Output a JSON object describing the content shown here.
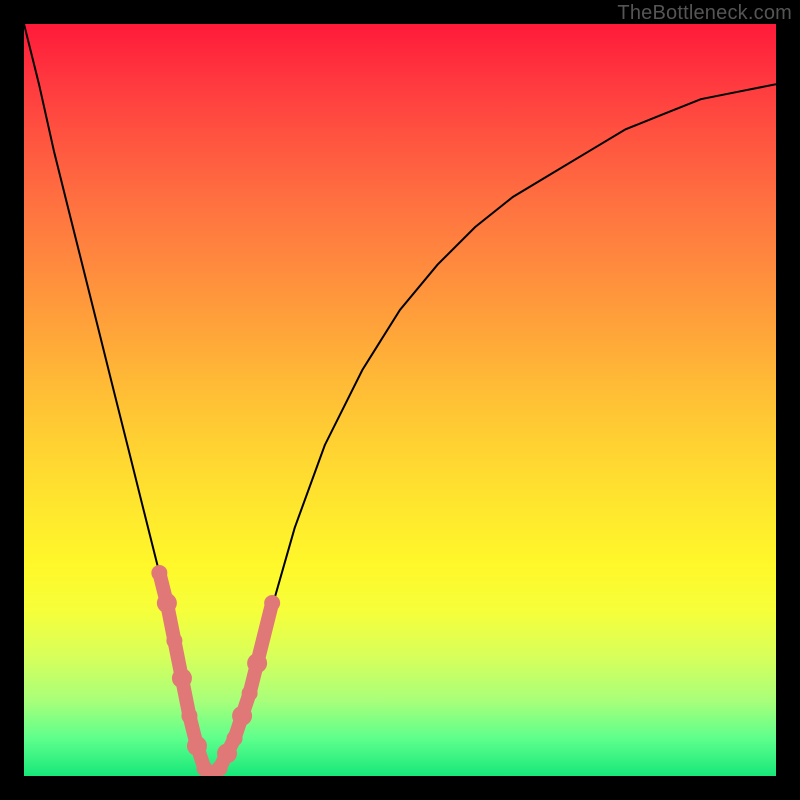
{
  "watermark": "TheBottleneck.com",
  "colors": {
    "marker": "#e17878",
    "curve": "#000000",
    "frame_bg_top": "#ff1a3a",
    "frame_bg_bottom": "#17e87a",
    "page_bg": "#000000"
  },
  "chart_data": {
    "type": "line",
    "title": "",
    "xlabel": "",
    "ylabel": "",
    "xlim": [
      0,
      100
    ],
    "ylim": [
      0,
      100
    ],
    "x": [
      0,
      2,
      4,
      6,
      8,
      10,
      12,
      14,
      16,
      18,
      20,
      21,
      22,
      23,
      24,
      25,
      26,
      28,
      30,
      32,
      36,
      40,
      45,
      50,
      55,
      60,
      65,
      70,
      75,
      80,
      85,
      90,
      95,
      100
    ],
    "series": [
      {
        "name": "bottleneck-curve",
        "values": [
          100,
          92,
          83,
          75,
          67,
          59,
          51,
          43,
          35,
          27,
          18,
          13,
          8,
          4,
          1,
          0,
          1,
          5,
          11,
          19,
          33,
          44,
          54,
          62,
          68,
          73,
          77,
          80,
          83,
          86,
          88,
          90,
          91,
          92
        ]
      }
    ],
    "markers": {
      "name": "highlighted-points",
      "points": [
        {
          "x": 18,
          "y": 27
        },
        {
          "x": 19,
          "y": 23
        },
        {
          "x": 20,
          "y": 18
        },
        {
          "x": 21,
          "y": 13
        },
        {
          "x": 22,
          "y": 8
        },
        {
          "x": 23,
          "y": 4
        },
        {
          "x": 24,
          "y": 1
        },
        {
          "x": 25,
          "y": 0
        },
        {
          "x": 26,
          "y": 1
        },
        {
          "x": 27,
          "y": 3
        },
        {
          "x": 28,
          "y": 5
        },
        {
          "x": 29,
          "y": 8
        },
        {
          "x": 30,
          "y": 11
        },
        {
          "x": 31,
          "y": 15
        },
        {
          "x": 33,
          "y": 23
        }
      ]
    }
  }
}
